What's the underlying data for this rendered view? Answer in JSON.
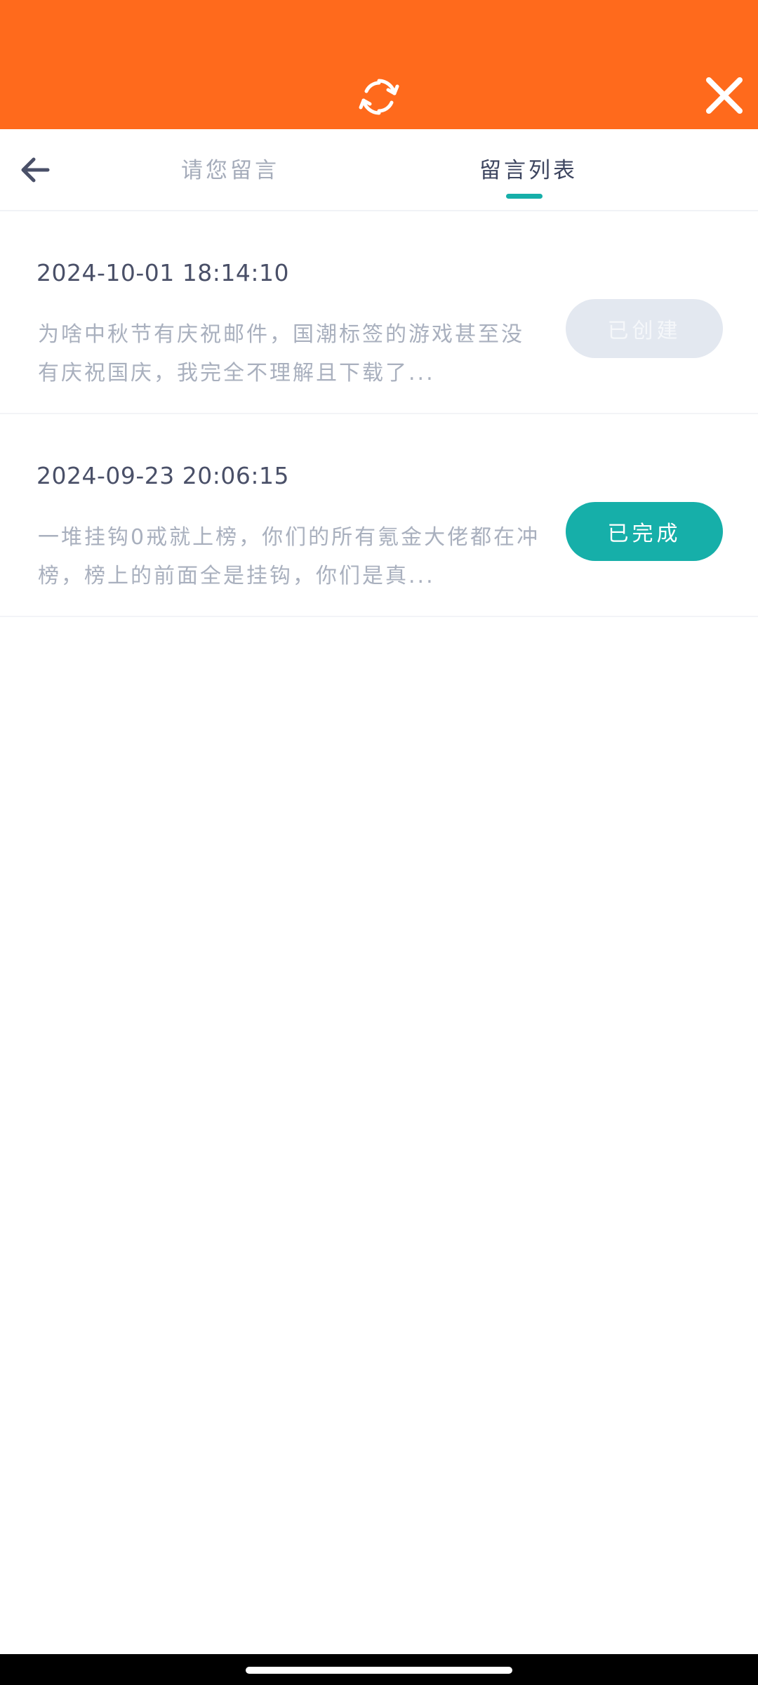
{
  "header": {
    "refresh_icon": "refresh-icon",
    "close_icon": "close-icon",
    "background": "#FF6A1C"
  },
  "tabs": {
    "back_icon": "arrow-left-icon",
    "leave_message": "请您留言",
    "message_list": "留言列表",
    "active": "message_list",
    "accent": "#16AFA9"
  },
  "messages": [
    {
      "time": "2024-10-01 18:14:10",
      "text": "为啥中秋节有庆祝邮件，国潮标签的游戏甚至没有庆祝国庆，我完全不理解且下载了...",
      "status": "已创建"
    },
    {
      "time": "2024-09-23 20:06:15",
      "text": "一堆挂钩0戒就上榜，你们的所有氪金大佬都在冲榜，榜上的前面全是挂钩，你们是真...",
      "status": "已完成"
    }
  ]
}
